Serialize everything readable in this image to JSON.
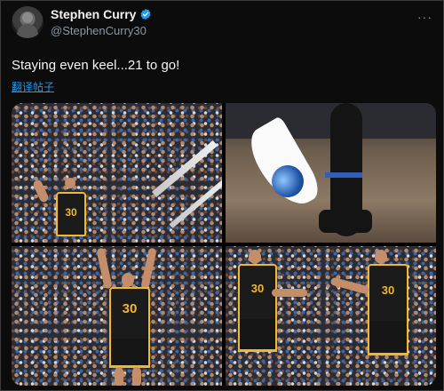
{
  "tweet": {
    "author": {
      "display_name": "Stephen Curry",
      "handle": "@StephenCurry30",
      "verified": true,
      "avatar_alt": "avatar"
    },
    "more_menu": "···",
    "text": "Staying even keel...21 to go!",
    "translate_link": "翻译帖子",
    "media": [
      {
        "jersey_number": "30"
      },
      {
        "jersey_number": ""
      },
      {
        "jersey_number": "30"
      },
      {
        "jersey_number": "30"
      }
    ]
  },
  "colors": {
    "background": "#0c0c0c",
    "text": "#e7e9ea",
    "muted": "#8b98a5",
    "link": "#1d9bf0",
    "verified": "#1d9bf0",
    "warriors_gold": "#f1b82d"
  }
}
